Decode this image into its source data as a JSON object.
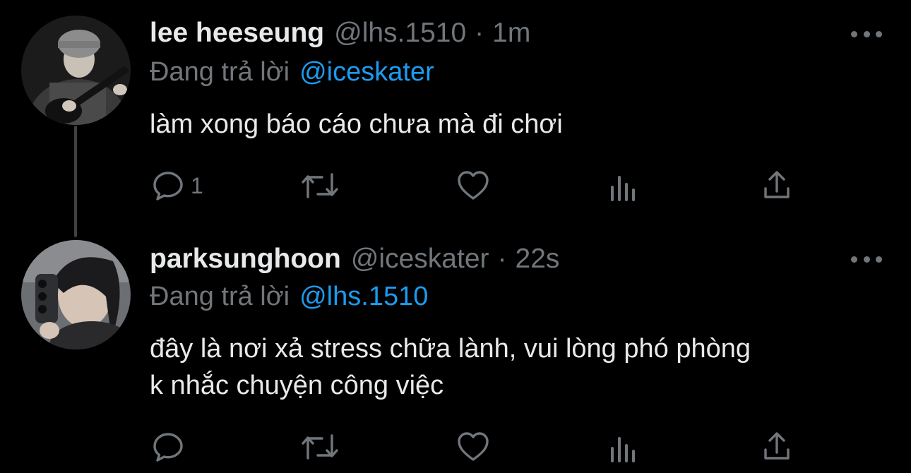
{
  "theme": {
    "background": "#000000",
    "text": "#e7e9ea",
    "muted": "#71767b",
    "link": "#1d9bf0",
    "thread_line": "#3e4144"
  },
  "tweets": [
    {
      "display_name": "lee heeseung",
      "handle": "@lhs.1510",
      "separator": "·",
      "time": "1m",
      "replying_label": "Đang trả lời",
      "replying_to": "@iceskater",
      "text": "làm xong báo cáo chưa mà đi chơi",
      "reply_count": "1",
      "avatar_icon": "avatar-photo-guitar",
      "actions": [
        "reply-icon",
        "retweet-icon",
        "like-icon",
        "views-icon",
        "share-icon"
      ]
    },
    {
      "display_name": "parksunghoon",
      "handle": "@iceskater",
      "separator": "·",
      "time": "22s",
      "replying_label": "Đang trả lời",
      "replying_to": "@lhs.1510",
      "text_lines": [
        "đây là nơi xả stress chữa lành, vui lòng phó phòng",
        "k nhắc chuyện công việc"
      ],
      "reply_count": "",
      "avatar_icon": "avatar-photo-selfie",
      "actions": [
        "reply-icon",
        "retweet-icon",
        "like-icon",
        "views-icon",
        "share-icon"
      ]
    }
  ]
}
